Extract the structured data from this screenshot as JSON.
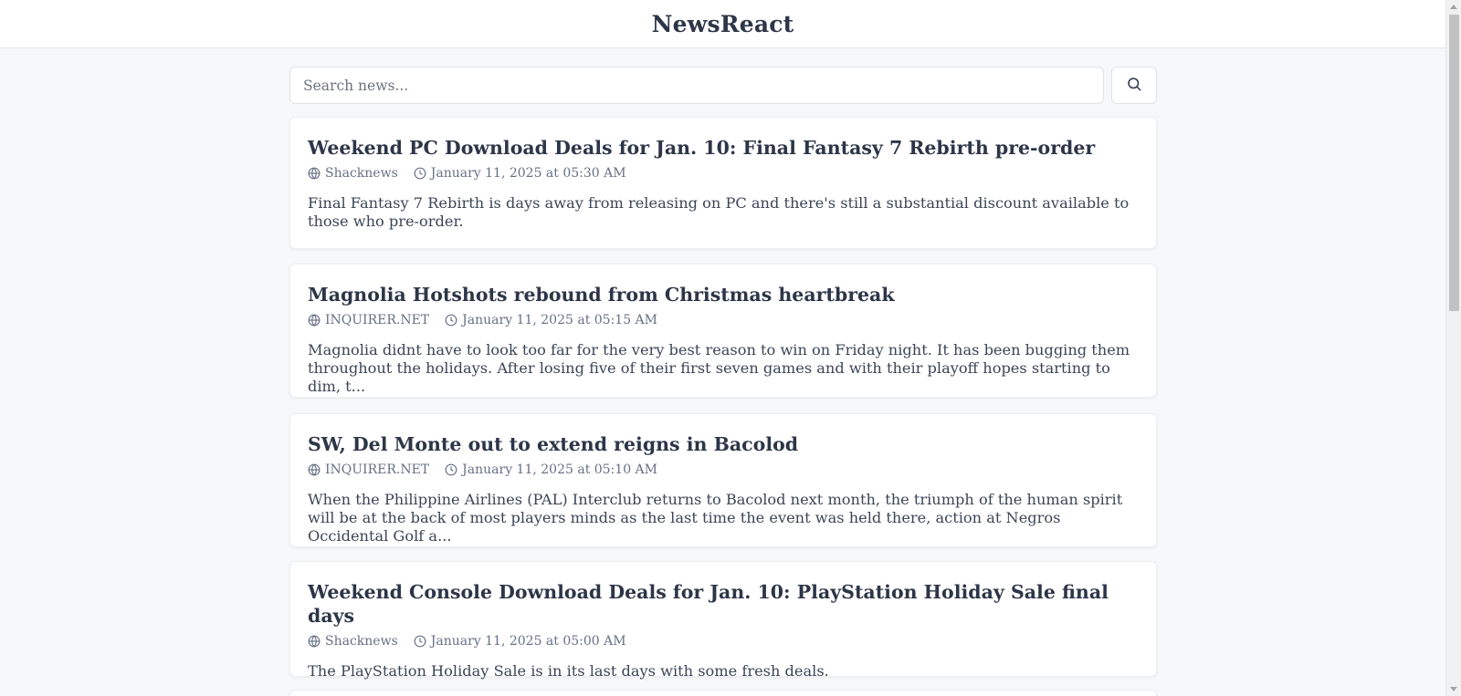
{
  "header": {
    "title": "NewsReact"
  },
  "search": {
    "placeholder": "Search news...",
    "value": ""
  },
  "icons": {
    "search": "search-icon",
    "source": "globe-icon",
    "time": "clock-icon"
  },
  "articles": [
    {
      "title": "Weekend PC Download Deals for Jan. 10: Final Fantasy 7 Rebirth pre-order",
      "source": "Shacknews",
      "date": "January 11, 2025 at 05:30 AM",
      "description": "Final Fantasy 7 Rebirth is days away from releasing on PC and there's still a substantial discount available to those who pre-order."
    },
    {
      "title": "Magnolia Hotshots rebound from Christmas heartbreak",
      "source": "INQUIRER.NET",
      "date": "January 11, 2025 at 05:15 AM",
      "description": "Magnolia didnt have to look too far for the very best reason to win on Friday night. It has been bugging them throughout the holidays. After losing five of their first seven games and with their playoff hopes starting to dim, t..."
    },
    {
      "title": "SW, Del Monte out to extend reigns in Bacolod",
      "source": "INQUIRER.NET",
      "date": "January 11, 2025 at 05:10 AM",
      "description": "When the Philippine Airlines (PAL) Interclub returns to Bacolod next month, the triumph of the human spirit will be at the back of most players minds as the last time the event was held there, action at Negros Occidental Golf a..."
    },
    {
      "title": "Weekend Console Download Deals for Jan. 10: PlayStation Holiday Sale final days",
      "source": "Shacknews",
      "date": "January 11, 2025 at 05:00 AM",
      "description": "The PlayStation Holiday Sale is in its last days with some fresh deals."
    }
  ]
}
